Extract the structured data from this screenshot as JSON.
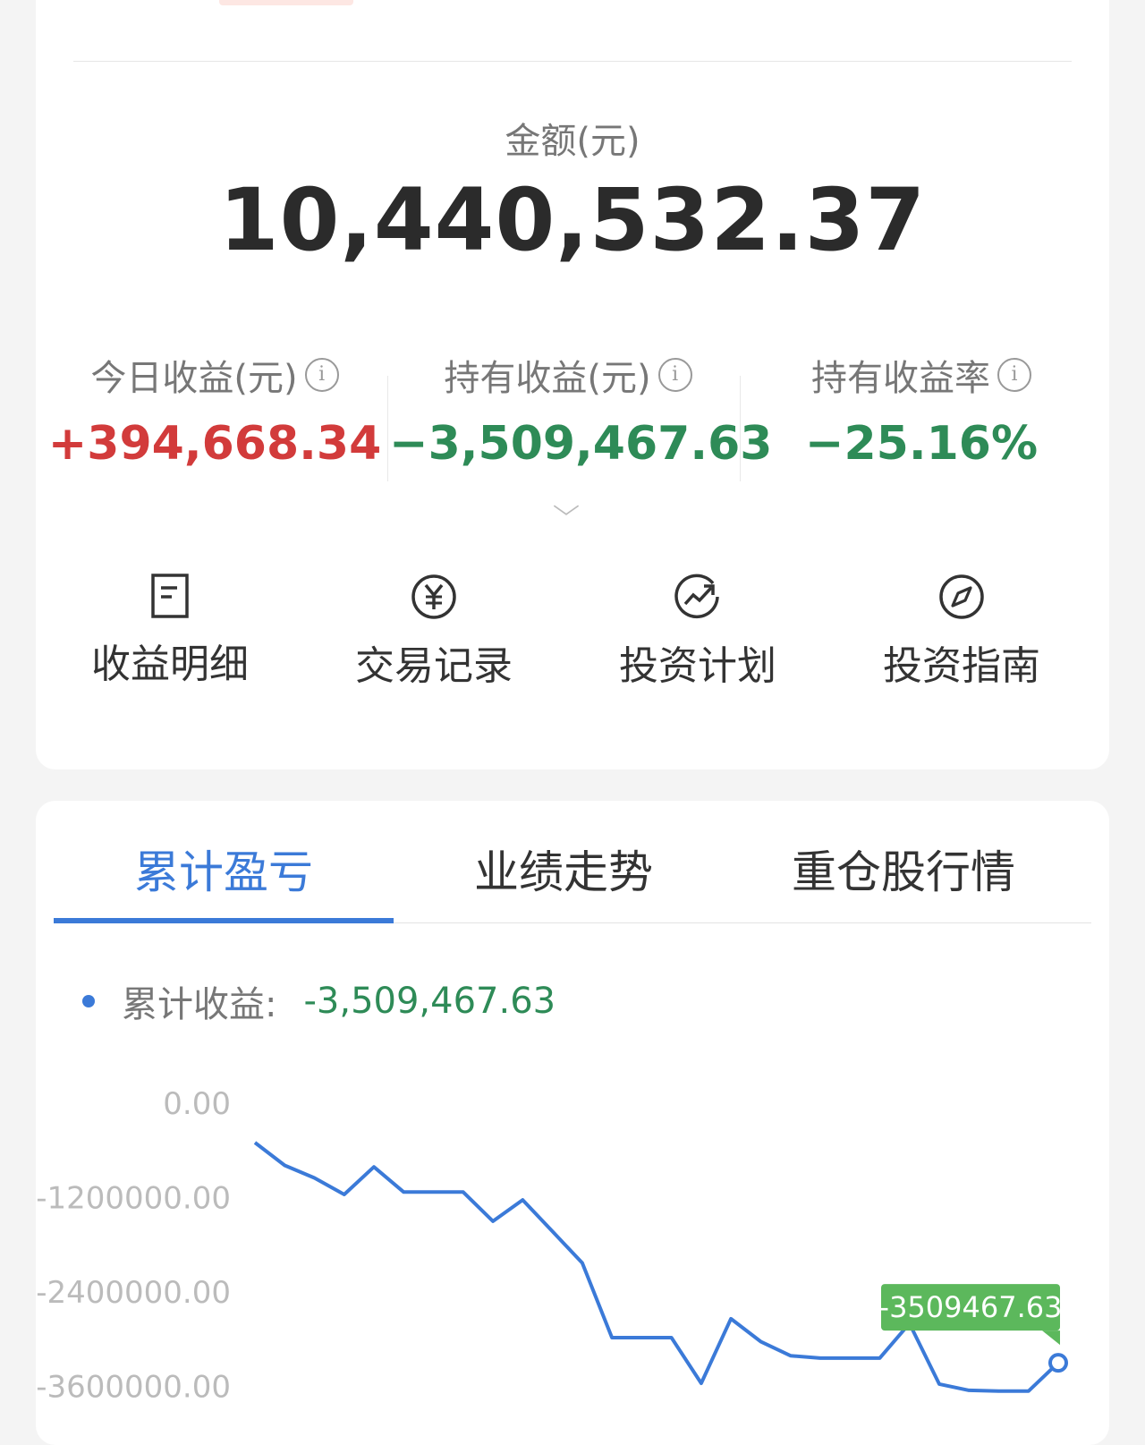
{
  "summary": {
    "amount_label": "金额(元)",
    "amount_value": "10,440,532.37",
    "stats": [
      {
        "label": "今日收益(元)",
        "value": "+394,668.34",
        "tone": "up"
      },
      {
        "label": "持有收益(元)",
        "value": "−3,509,467.63",
        "tone": "down"
      },
      {
        "label": "持有收益率",
        "value": "−25.16%",
        "tone": "down"
      }
    ],
    "quick_actions": [
      {
        "label": "收益明细",
        "icon": "document-icon"
      },
      {
        "label": "交易记录",
        "icon": "yuan-circle-icon"
      },
      {
        "label": "投资计划",
        "icon": "trend-up-icon"
      },
      {
        "label": "投资指南",
        "icon": "compass-icon"
      }
    ]
  },
  "tabs": [
    {
      "label": "累计盈亏",
      "active": true
    },
    {
      "label": "业绩走势",
      "active": false
    },
    {
      "label": "重仓股行情",
      "active": false
    }
  ],
  "legend": {
    "label": "累计收益:",
    "value": "-3,509,467.63"
  },
  "colors": {
    "accent": "#3b7ad8",
    "up": "#d23b3b",
    "down": "#2e8b57",
    "tooltip_bg": "#5cb85c"
  },
  "chart_data": {
    "type": "line",
    "title": "",
    "xlabel": "",
    "ylabel": "",
    "yticks": [
      "0.00",
      "-1200000.00",
      "-2400000.00",
      "-3600000.00"
    ],
    "ylim": [
      -3600000,
      0
    ],
    "series": [
      {
        "values": [
          -500000,
          -790000,
          -950000,
          -1160000,
          -810000,
          -1130000,
          -1130000,
          -1130000,
          -1500000,
          -1230000,
          -1630000,
          -2030000,
          -2980000,
          -2980000,
          -2980000,
          -3560000,
          -2740000,
          -3030000,
          -3210000,
          -3240000,
          -3240000,
          -3240000,
          -2800000,
          -3570000,
          -3650000,
          -3660000,
          -3660000,
          -3300000
        ]
      }
    ],
    "tooltip_value": "-3509467.63"
  }
}
